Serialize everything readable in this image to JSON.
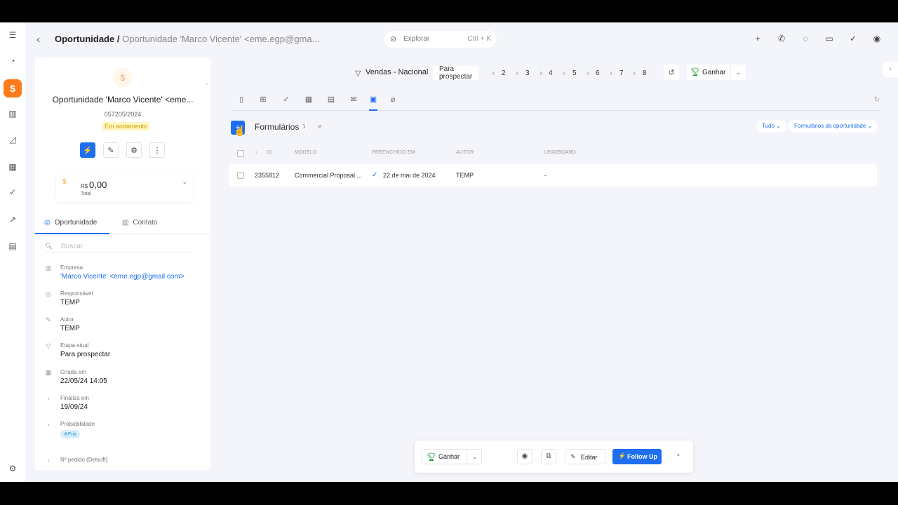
{
  "topbar": {
    "crumb_root": "Oportunidade /",
    "crumb_rest": "Oportunidade 'Marco Vicente' <eme.egp@gma...",
    "search_placeholder": "Explorar",
    "search_shortcut": "Ctrl + K"
  },
  "card": {
    "name": "Oportunidade 'Marco Vicente' <eme...",
    "code": "057205/2024",
    "status": "Em andamento",
    "value_currency": "R$",
    "value_amount": "0,00",
    "value_label": "Total",
    "tabs": [
      "Oportunidade",
      "Contato"
    ],
    "search_placeholder": "Buscar",
    "fields": [
      {
        "label": "Empresa",
        "value": "'Marco Vicente' <eme.egp@gmail.com>",
        "icon": "building-icon"
      },
      {
        "label": "Responsável",
        "value": "TEMP",
        "icon": "user-icon"
      },
      {
        "label": "Autor",
        "value": "TEMP",
        "icon": "pencil-icon"
      },
      {
        "label": "Etapa atual",
        "value": "Para prospectar",
        "icon": "funnel-icon"
      },
      {
        "label": "Criada em",
        "value": "22/05/24 14:05",
        "icon": "calendar-icon"
      },
      {
        "label": "Finaliza em",
        "value": "19/09/24",
        "icon": "chevron-right-icon"
      },
      {
        "label": "Probabilidade",
        "value": "Fria",
        "icon": "chevron-right-icon"
      },
      {
        "label": "Nº pedido (Delsoft)",
        "value": "",
        "icon": "chevron-right-icon"
      }
    ]
  },
  "pipeline": {
    "name": "Vendas - Nacional",
    "stages": [
      "Para prospectar",
      "2",
      "3",
      "4",
      "5",
      "6",
      "7",
      "8"
    ],
    "win_label": "Ganhar"
  },
  "list": {
    "title": "Formulários",
    "count": "1",
    "filter_all": "Tudo",
    "filter_scope": "Formulários da oportunidade",
    "columns": [
      "ID",
      "MODELO",
      "PREENCHIDO EM",
      "AUTOR",
      "LEADBOARD"
    ],
    "rows": [
      {
        "id": "2355812",
        "model": "Commercial Proposal ...",
        "filled": "22 de mai de 2024",
        "author": "TEMP",
        "leadboard": "-"
      }
    ]
  },
  "bottom": {
    "win_label": "Ganhar",
    "edit_label": "Editar",
    "follow_label": "Follow Up"
  },
  "colors": {
    "accent": "#1e6ef0",
    "brand": "#ff7a1a",
    "win": "#1a9a3a"
  }
}
